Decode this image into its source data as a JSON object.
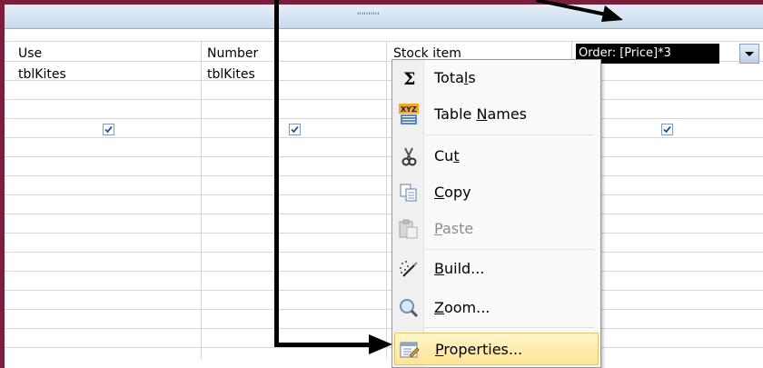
{
  "splitter": {
    "grip": "''''''''''"
  },
  "columns": [
    {
      "field": "Use",
      "table": "tblKites",
      "show": true
    },
    {
      "field": "Number",
      "table": "tblKites",
      "show": true
    },
    {
      "field": "Stock item",
      "table": "",
      "show": false
    },
    {
      "field": "Order: [Price]*3",
      "table": "",
      "show": true
    }
  ],
  "context_menu": {
    "items": [
      {
        "icon": "sigma-icon",
        "label_pre": "Tota",
        "label_key": "l",
        "label_post": "s",
        "enabled": true
      },
      {
        "icon": "table-names-icon",
        "icon_text": "XYZ",
        "label_pre": "Table ",
        "label_key": "N",
        "label_post": "ames",
        "enabled": true
      },
      {
        "icon": "scissors-icon",
        "label_pre": "Cu",
        "label_key": "t",
        "label_post": "",
        "enabled": true
      },
      {
        "icon": "copy-icon",
        "label_pre": "",
        "label_key": "C",
        "label_post": "opy",
        "enabled": true
      },
      {
        "icon": "paste-icon",
        "label_pre": "",
        "label_key": "P",
        "label_post": "aste",
        "enabled": false
      },
      {
        "icon": "build-wand-icon",
        "label_pre": "",
        "label_key": "B",
        "label_post": "uild...",
        "enabled": true
      },
      {
        "icon": "zoom-magnifier-icon",
        "label_pre": "",
        "label_key": "Z",
        "label_post": "oom...",
        "enabled": true
      },
      {
        "icon": "properties-icon",
        "label_pre": "",
        "label_key": "P",
        "label_post": "roperties...",
        "enabled": true,
        "highlighted": true
      }
    ]
  },
  "colors": {
    "border": "#7b1e3b",
    "highlight": "#ffe494"
  }
}
